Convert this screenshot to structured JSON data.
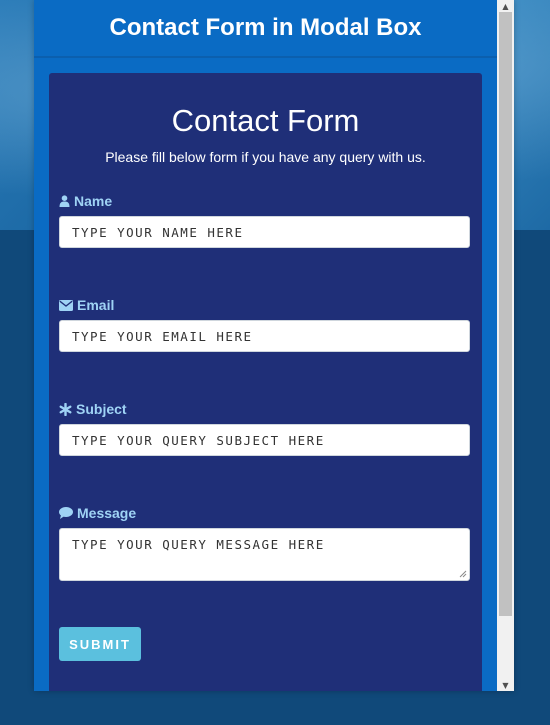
{
  "modal": {
    "title": "Contact Form in Modal Box"
  },
  "form": {
    "title": "Contact Form",
    "subtitle": "Please fill below form if you have any query with us.",
    "fields": [
      {
        "label": "Name",
        "icon": "user-icon",
        "placeholder": "TYPE YOUR NAME HERE"
      },
      {
        "label": "Email",
        "icon": "envelope-icon",
        "placeholder": "TYPE YOUR EMAIL HERE"
      },
      {
        "label": "Subject",
        "icon": "asterisk-icon",
        "placeholder": "TYPE YOUR QUERY SUBJECT HERE"
      },
      {
        "label": "Message",
        "icon": "comment-icon",
        "placeholder": "TYPE YOUR QUERY MESSAGE HERE"
      }
    ],
    "submit_label": "SUBMIT"
  },
  "colors": {
    "page_background": "#10497a",
    "modal_header": "#0a6bc4",
    "card_background": "#1f2f78",
    "label_color": "#9fd3f5",
    "submit_button": "#5bc0de"
  }
}
